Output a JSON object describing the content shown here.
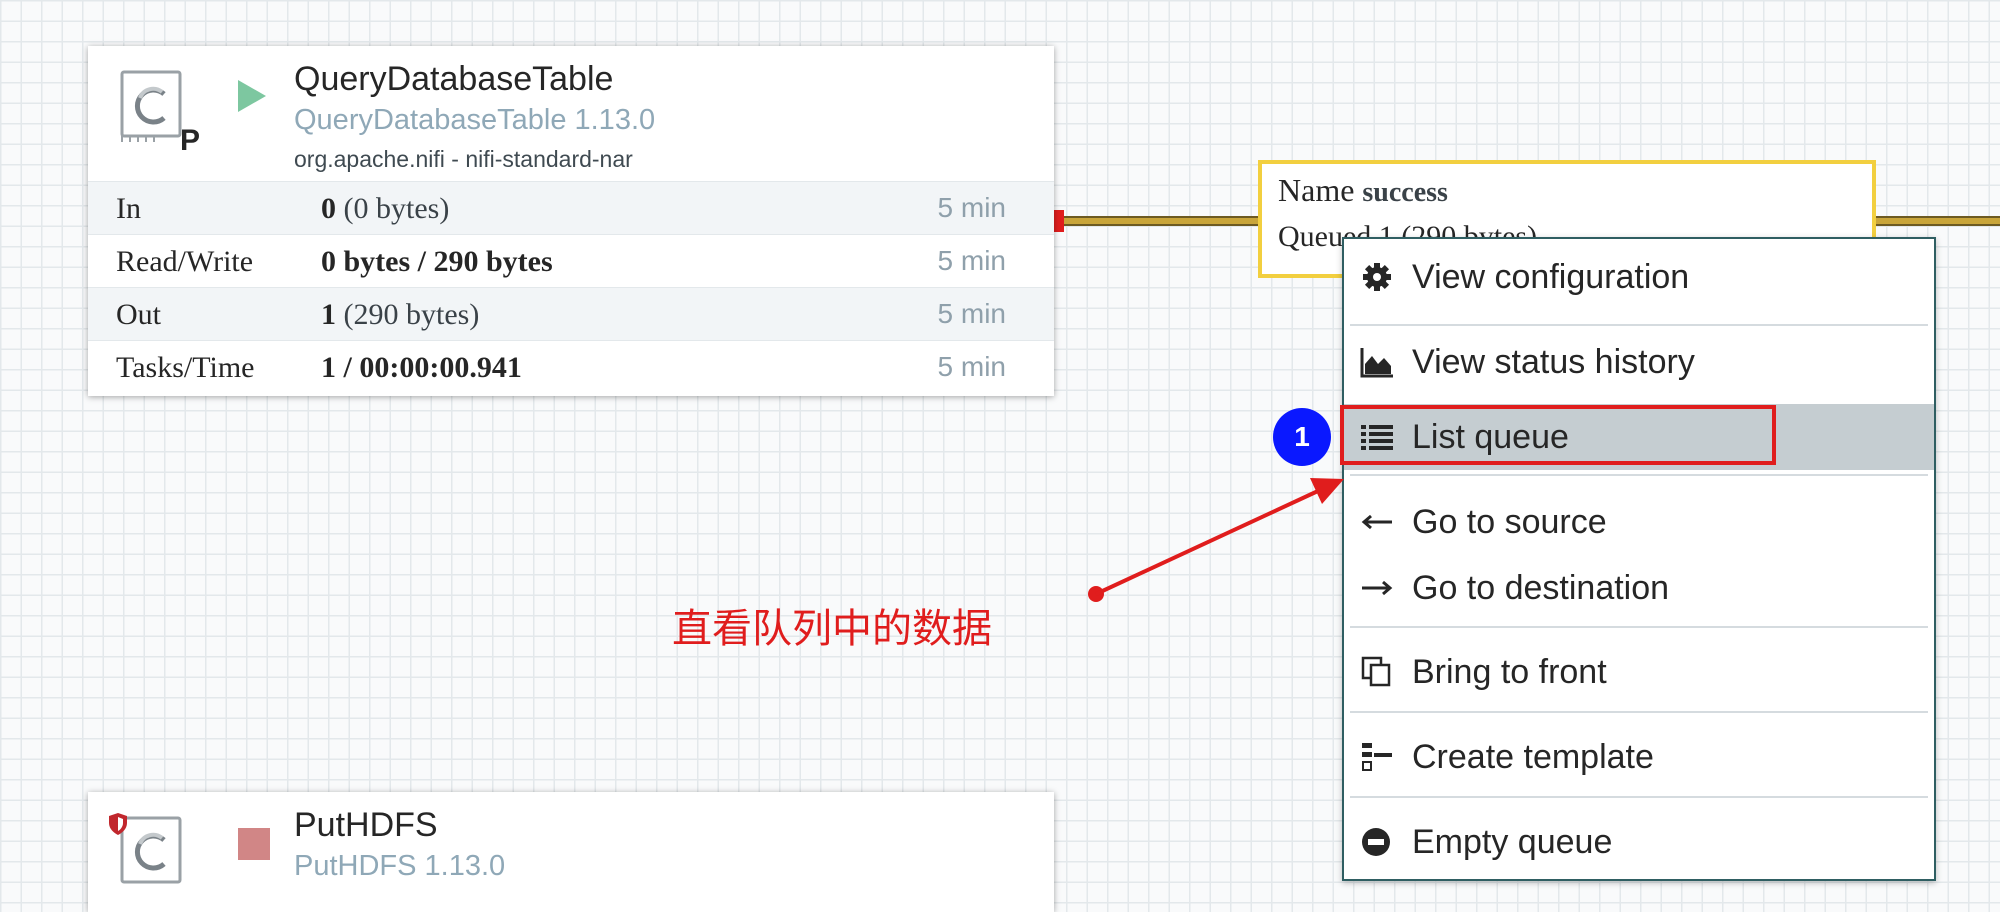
{
  "processors": {
    "query": {
      "name": "QueryDatabaseTable",
      "type": "QueryDatabaseTable 1.13.0",
      "bundle": "org.apache.nifi - nifi-standard-nar",
      "badge": "P",
      "state": "running",
      "icon": "processor-icon",
      "stats": [
        {
          "label": "In",
          "value_bold": "0",
          "value_rest": " (0 bytes)",
          "period": "5 min"
        },
        {
          "label": "Read/Write",
          "value_bold": "0 bytes / 290 bytes",
          "value_rest": "",
          "period": "5 min"
        },
        {
          "label": "Out",
          "value_bold": "1",
          "value_rest": " (290 bytes)",
          "period": "5 min"
        },
        {
          "label": "Tasks/Time",
          "value_bold": "1 / 00:00:00.941",
          "value_rest": "",
          "period": "5 min"
        }
      ]
    },
    "puthdfs": {
      "name": "PutHDFS",
      "type": "PutHDFS 1.13.0",
      "state": "stopped",
      "icon": "processor-icon"
    }
  },
  "connection": {
    "name_label": "Name",
    "name_value": "success",
    "queued_text": "Queued 1 (290 bytes)"
  },
  "context_menu": {
    "items": [
      {
        "label": "View configuration",
        "icon": "gear-icon"
      },
      {
        "label": "View status history",
        "icon": "area-chart-icon"
      },
      {
        "label": "List queue",
        "icon": "list-icon"
      },
      {
        "label": "Go to source",
        "icon": "arrow-left-icon"
      },
      {
        "label": "Go to destination",
        "icon": "arrow-right-icon"
      },
      {
        "label": "Bring to front",
        "icon": "copy-icon"
      },
      {
        "label": "Create template",
        "icon": "template-icon"
      },
      {
        "label": "Empty queue",
        "icon": "minus-circle-icon"
      }
    ],
    "active_item": "List queue"
  },
  "annotation": {
    "badge_number": "1",
    "text": "直看队列中的数据"
  },
  "colors": {
    "accent_red": "#e01d1d",
    "badge_blue": "#0a18ff",
    "connection_yellow": "#f2cf3f",
    "menu_border": "#2f5e62",
    "running_green": "#7dc7a0",
    "stopped_red": "#d18686"
  }
}
